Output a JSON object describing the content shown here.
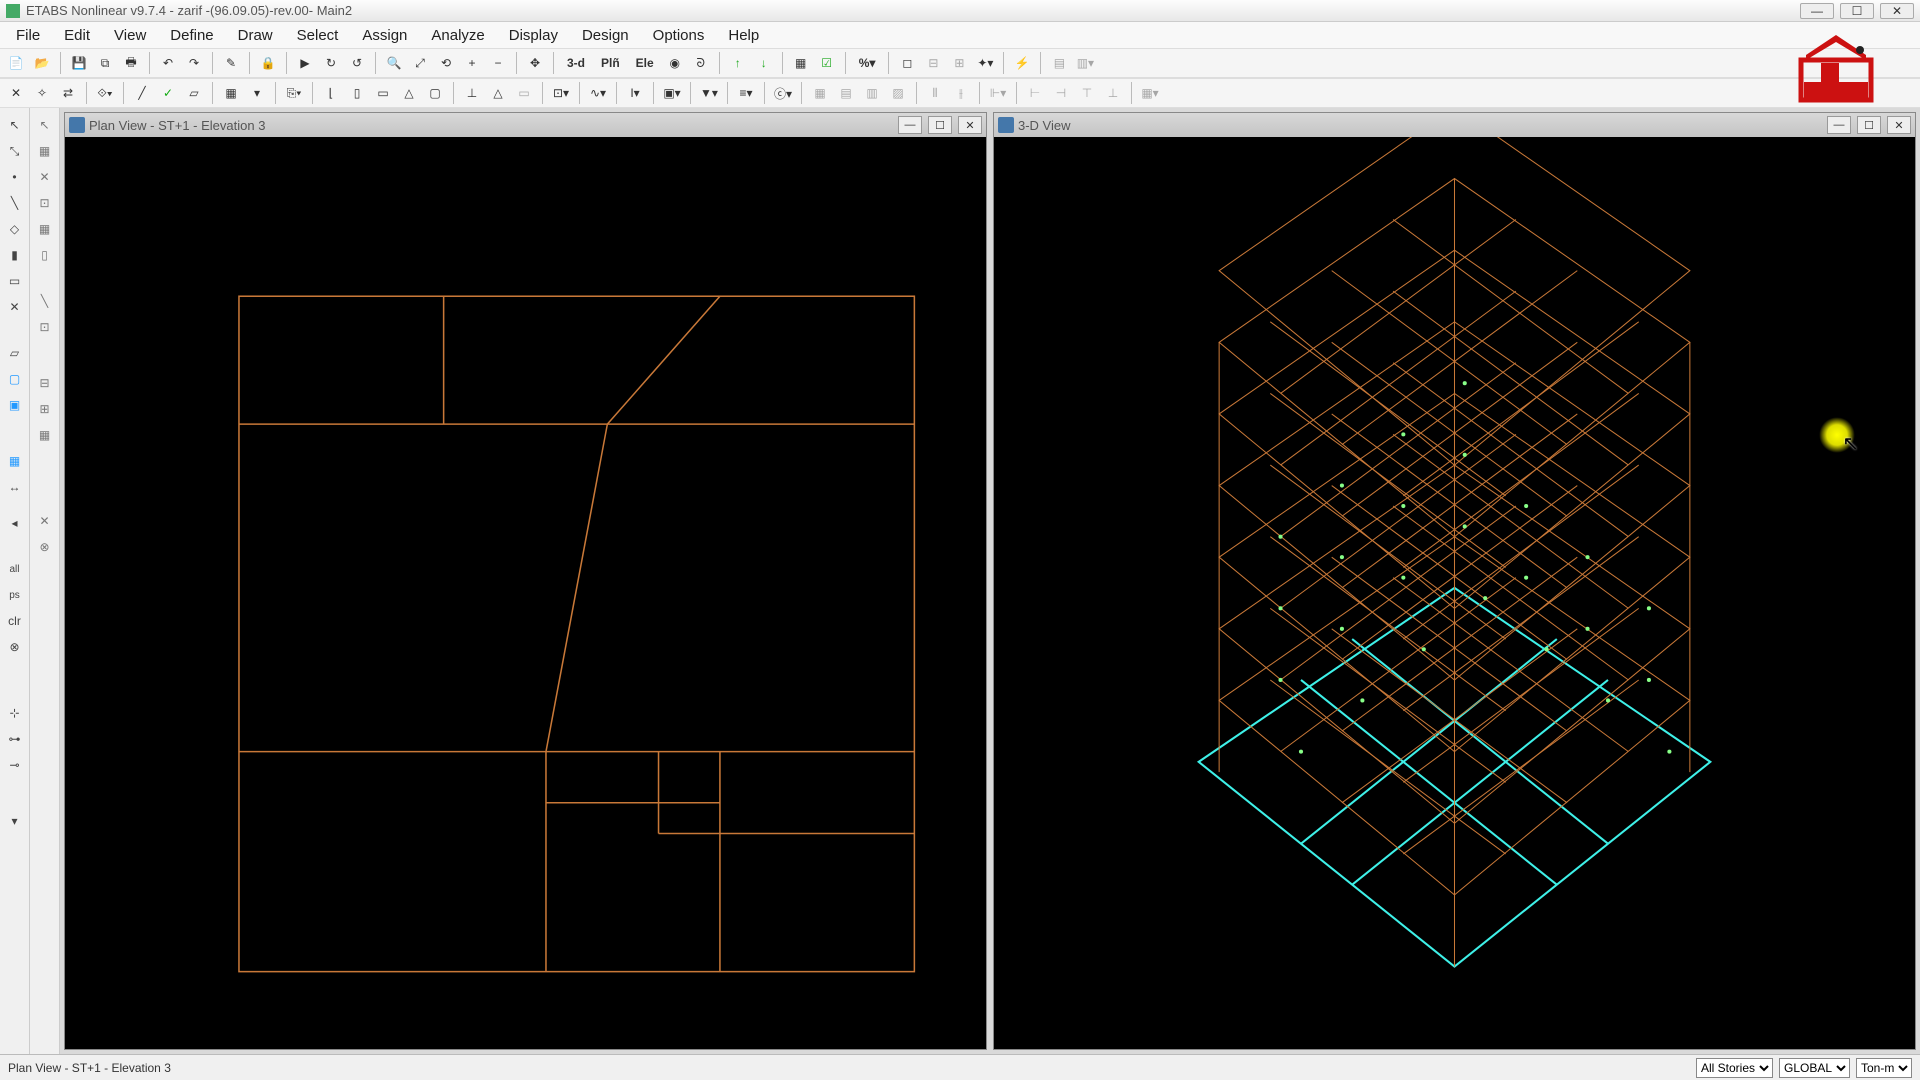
{
  "window": {
    "title": "ETABS Nonlinear v9.7.4 - zarif -(96.09.05)-rev.00- Main2"
  },
  "menu": {
    "items": [
      "File",
      "Edit",
      "View",
      "Define",
      "Draw",
      "Select",
      "Assign",
      "Analyze",
      "Display",
      "Design",
      "Options",
      "Help"
    ]
  },
  "toolbar1": {
    "btn_3d": "3-d",
    "btn_plan": "Plñ",
    "btn_elev": "Ele"
  },
  "left_view": {
    "title": "Plan View - ST+1 - Elevation 3"
  },
  "right_view": {
    "title": "3-D View"
  },
  "statusbar": {
    "text": "Plan View - ST+1 - Elevation 3",
    "stories": "All Stories",
    "coords": "GLOBAL",
    "units": "Ton-m"
  },
  "labels": {
    "all": "all",
    "ps": "ps"
  }
}
